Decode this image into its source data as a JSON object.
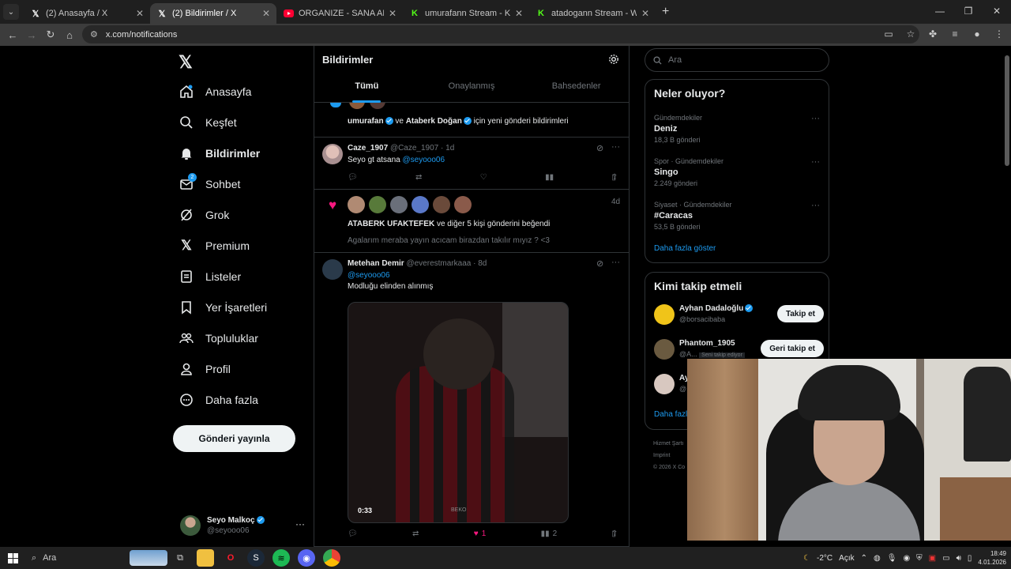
{
  "browser": {
    "tabs": [
      {
        "title": "(2) Anasayfa / X",
        "favicon": "x-logo",
        "color": "#ffffff"
      },
      {
        "title": "(2) Bildirimler / X",
        "favicon": "x-logo",
        "color": "#ffffff"
      },
      {
        "title": "ORGANIZE - SANA ANLATMAK",
        "favicon": "youtube-icon",
        "color": "#ff0033"
      },
      {
        "title": "umurafann Stream - Kick Dashb",
        "favicon": "kick-icon",
        "color": "#53fc18"
      },
      {
        "title": "atadogann Stream - Watch Live",
        "favicon": "kick-icon",
        "color": "#53fc18"
      }
    ],
    "url": "x.com/notifications"
  },
  "sidebar": {
    "items": [
      {
        "label": "Anasayfa",
        "icon": "home-icon"
      },
      {
        "label": "Keşfet",
        "icon": "search-icon"
      },
      {
        "label": "Bildirimler",
        "icon": "bell-icon"
      },
      {
        "label": "Sohbet",
        "icon": "mail-icon",
        "badge": "2"
      },
      {
        "label": "Grok",
        "icon": "grok-icon"
      },
      {
        "label": "Premium",
        "icon": "x-icon"
      },
      {
        "label": "Listeler",
        "icon": "list-icon"
      },
      {
        "label": "Yer İşaretleri",
        "icon": "bookmark-icon"
      },
      {
        "label": "Topluluklar",
        "icon": "communities-icon"
      },
      {
        "label": "Profil",
        "icon": "profile-icon"
      },
      {
        "label": "Daha fazla",
        "icon": "more-circle-icon"
      }
    ],
    "post_button": "Gönderi yayınla",
    "account": {
      "name": "Seyo Malkoç",
      "handle": "@seyooo06"
    }
  },
  "main": {
    "title": "Bildirimler",
    "tabs": [
      "Tümü",
      "Onaylanmış",
      "Bahsedenler"
    ],
    "n1": {
      "u1": "umurafan",
      "and": "ve",
      "u2": "Ataberk Doğan",
      "rest": "için yeni gönderi bildirimleri"
    },
    "n2": {
      "name": "Caze_1907",
      "handle": "@Caze_1907",
      "time": "· 1d",
      "text": "Seyo gt atsana",
      "mention": "@seyooo06"
    },
    "n3": {
      "time": "4d",
      "who": "ATABERK UFAKTEFEK",
      "rest": "ve diğer 5 kişi gönderini beğendi",
      "quote": "Agalarım meraba yayın acıcam birazdan takılır mıyız ? <3"
    },
    "n4": {
      "name": "Metehan Demir",
      "handle": "@everestmarkaaa",
      "time": "· 8d",
      "mention": "@seyooo06",
      "text": "Modluğu elinden alınmış",
      "duration": "0:33",
      "beko": "BEKO",
      "likes": "1",
      "views": "2"
    }
  },
  "right": {
    "search_placeholder": "Ara",
    "trends_title": "Neler oluyor?",
    "trends": [
      {
        "cat": "Gündemdekiler",
        "title": "Deniz",
        "count": "18,3 B gönderi"
      },
      {
        "cat": "Spor · Gündemdekiler",
        "title": "Singo",
        "count": "2.249 gönderi"
      },
      {
        "cat": "Siyaset · Gündemdekiler",
        "title": "#Caracas",
        "count": "53,5 B gönderi"
      }
    ],
    "show_more": "Daha fazla göster",
    "who_title": "Kimi takip etmeli",
    "who": [
      {
        "name": "Ayhan Dadaloğlu",
        "handle": "@borsacibaba",
        "button": "Takip et"
      },
      {
        "name": "Phantom_1905",
        "handle": "@A...",
        "note": "Seni takip ediyor",
        "button": "Geri takip et"
      },
      {
        "name": "Ay",
        "handle": "@..."
      }
    ],
    "show_more2": "Daha fazl",
    "footer": [
      "Hizmet Şartı",
      "Imprint",
      "© 2026 X Co"
    ]
  },
  "taskbar": {
    "search": "Ara",
    "weather": "-2°C",
    "weather_text": "Açık",
    "time": "18:49",
    "date": "4.01.2026"
  },
  "colors": {
    "accent": "#1d9bf0",
    "like": "#f91880",
    "bg": "#000000"
  }
}
